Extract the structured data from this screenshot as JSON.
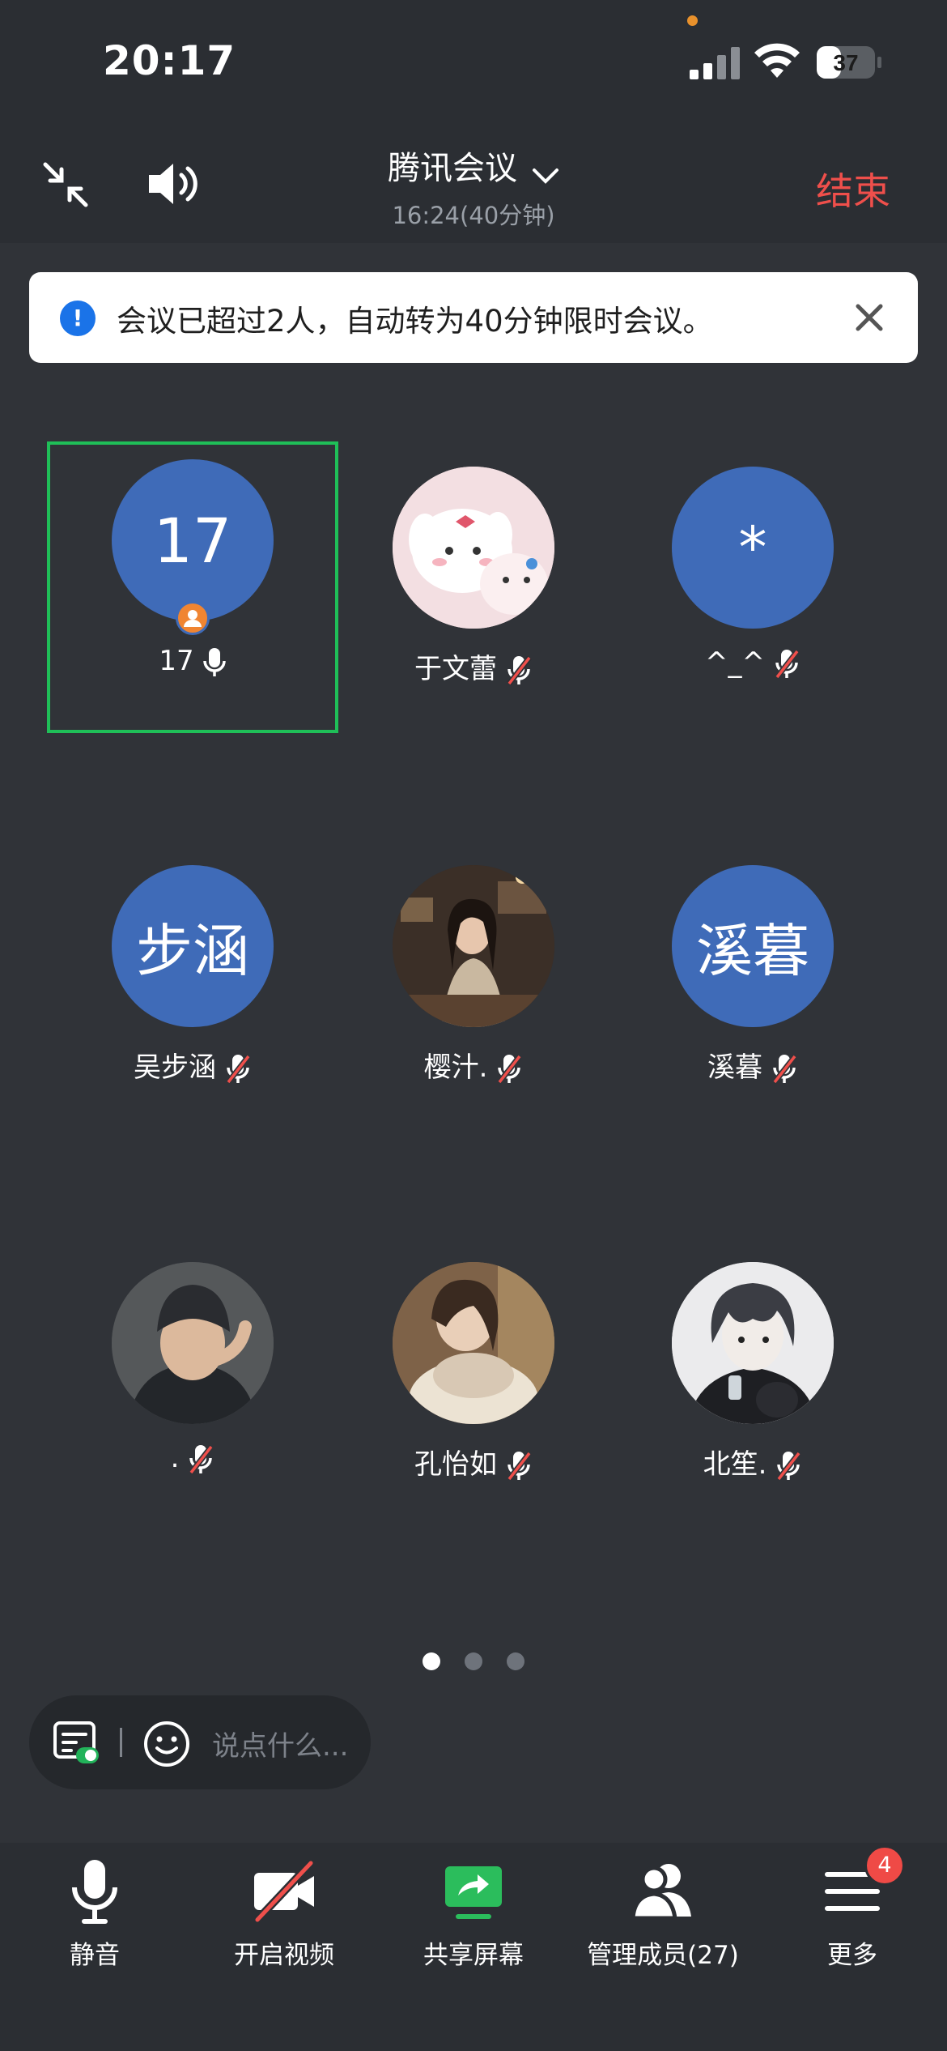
{
  "status_bar": {
    "time": "20:17",
    "battery": "37"
  },
  "header": {
    "title": "腾讯会议",
    "time": "16:24(40分钟)",
    "end_label": "结束"
  },
  "banner": {
    "text": "会议已超过2人，自动转为40分钟限时会议。"
  },
  "participants": [
    {
      "name": "17",
      "avatar_text": "17",
      "mic": "on",
      "active": true,
      "host": true
    },
    {
      "name": "于文蕾",
      "avatar_text": "",
      "mic": "muted"
    },
    {
      "name": "^_^",
      "avatar_text": "*",
      "mic": "muted"
    },
    {
      "name": "吴步涵",
      "avatar_text": "步涵",
      "mic": "muted"
    },
    {
      "name": "樱汁.",
      "avatar_text": "",
      "mic": "muted"
    },
    {
      "name": "溪暮",
      "avatar_text": "溪暮",
      "mic": "muted"
    },
    {
      "name": ".",
      "avatar_text": "",
      "mic": "muted"
    },
    {
      "name": "孔怡如",
      "avatar_text": "",
      "mic": "muted"
    },
    {
      "name": "北笙.",
      "avatar_text": "",
      "mic": "muted"
    }
  ],
  "pagination": {
    "current": 1,
    "total": 3
  },
  "chat": {
    "placeholder": "说点什么..."
  },
  "toolbar": {
    "mute": "静音",
    "video": "开启视频",
    "share": "共享屏幕",
    "members": "管理成员(27)",
    "more": "更多",
    "more_badge": "4"
  },
  "colors": {
    "background": "#2b2e33",
    "content_bg": "#303338",
    "end_red": "#ef4f4b",
    "active_border": "#1fbf58",
    "avatar_blue": "#3f6bb8",
    "host_badge": "#f08532",
    "share_green": "#2bbd5c",
    "info_blue": "#1a73e8"
  }
}
